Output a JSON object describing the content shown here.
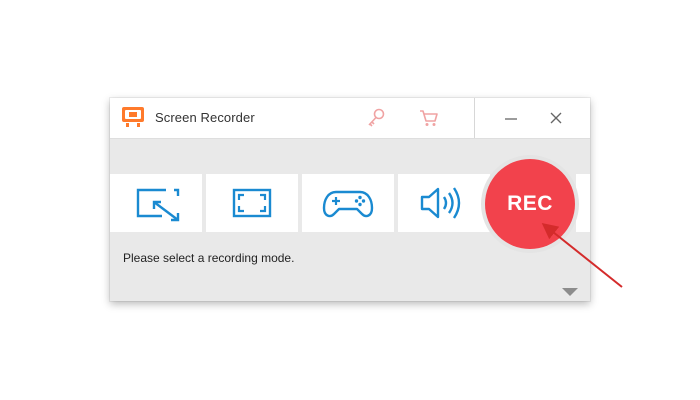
{
  "window": {
    "title": "Screen Recorder",
    "app_icon": "orange-monitor-icon",
    "toolbar_icons": [
      "key-icon",
      "cart-icon"
    ],
    "window_controls": [
      "minimize-icon",
      "close-icon"
    ]
  },
  "modes": [
    {
      "name": "custom-region-mode",
      "icon": "region-arrow-icon"
    },
    {
      "name": "fullscreen-mode",
      "icon": "fullscreen-icon"
    },
    {
      "name": "game-mode",
      "icon": "gamepad-icon"
    },
    {
      "name": "audio-only-mode",
      "icon": "speaker-icon"
    }
  ],
  "rec_button": {
    "label": "REC",
    "color": "#f2424c"
  },
  "status_message": "Please select a recording mode.",
  "colors": {
    "accent_blue": "#1a8ad1",
    "accent_orange": "#ff7a2b",
    "rec_red": "#f2424c",
    "annotation_arrow": "#d42b2b",
    "toolbar_icon_pink": "#f0a3a3"
  }
}
